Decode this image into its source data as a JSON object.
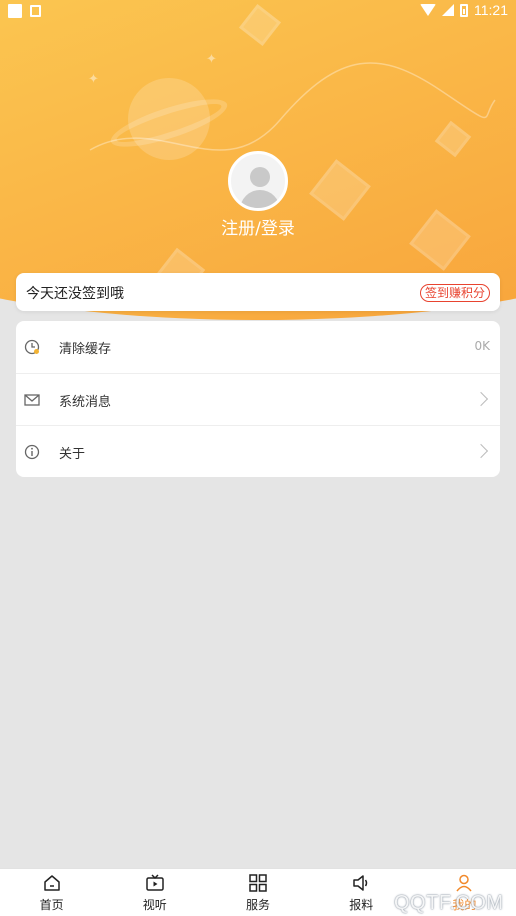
{
  "status_bar": {
    "time": "11:21"
  },
  "profile": {
    "login_label": "注册/登录"
  },
  "signin": {
    "text": "今天还没签到哦",
    "button": "签到赚积分"
  },
  "menu": {
    "items": [
      {
        "label": "清除缓存",
        "value": "0K",
        "icon": "clock-icon"
      },
      {
        "label": "系统消息",
        "icon": "mail-icon"
      },
      {
        "label": "关于",
        "icon": "info-icon"
      }
    ]
  },
  "tabbar": {
    "tabs": [
      {
        "label": "首页",
        "icon": "home-icon"
      },
      {
        "label": "视听",
        "icon": "tv-icon"
      },
      {
        "label": "服务",
        "icon": "grid-icon"
      },
      {
        "label": "报料",
        "icon": "speaker-icon"
      },
      {
        "label": "我的",
        "icon": "person-icon",
        "active": true
      }
    ]
  },
  "colors": {
    "accent": "#f2892a",
    "signin_red": "#e8432f",
    "hero_start": "#fde06a",
    "hero_end": "#f8a23a"
  },
  "watermark": "QQTF.COM"
}
